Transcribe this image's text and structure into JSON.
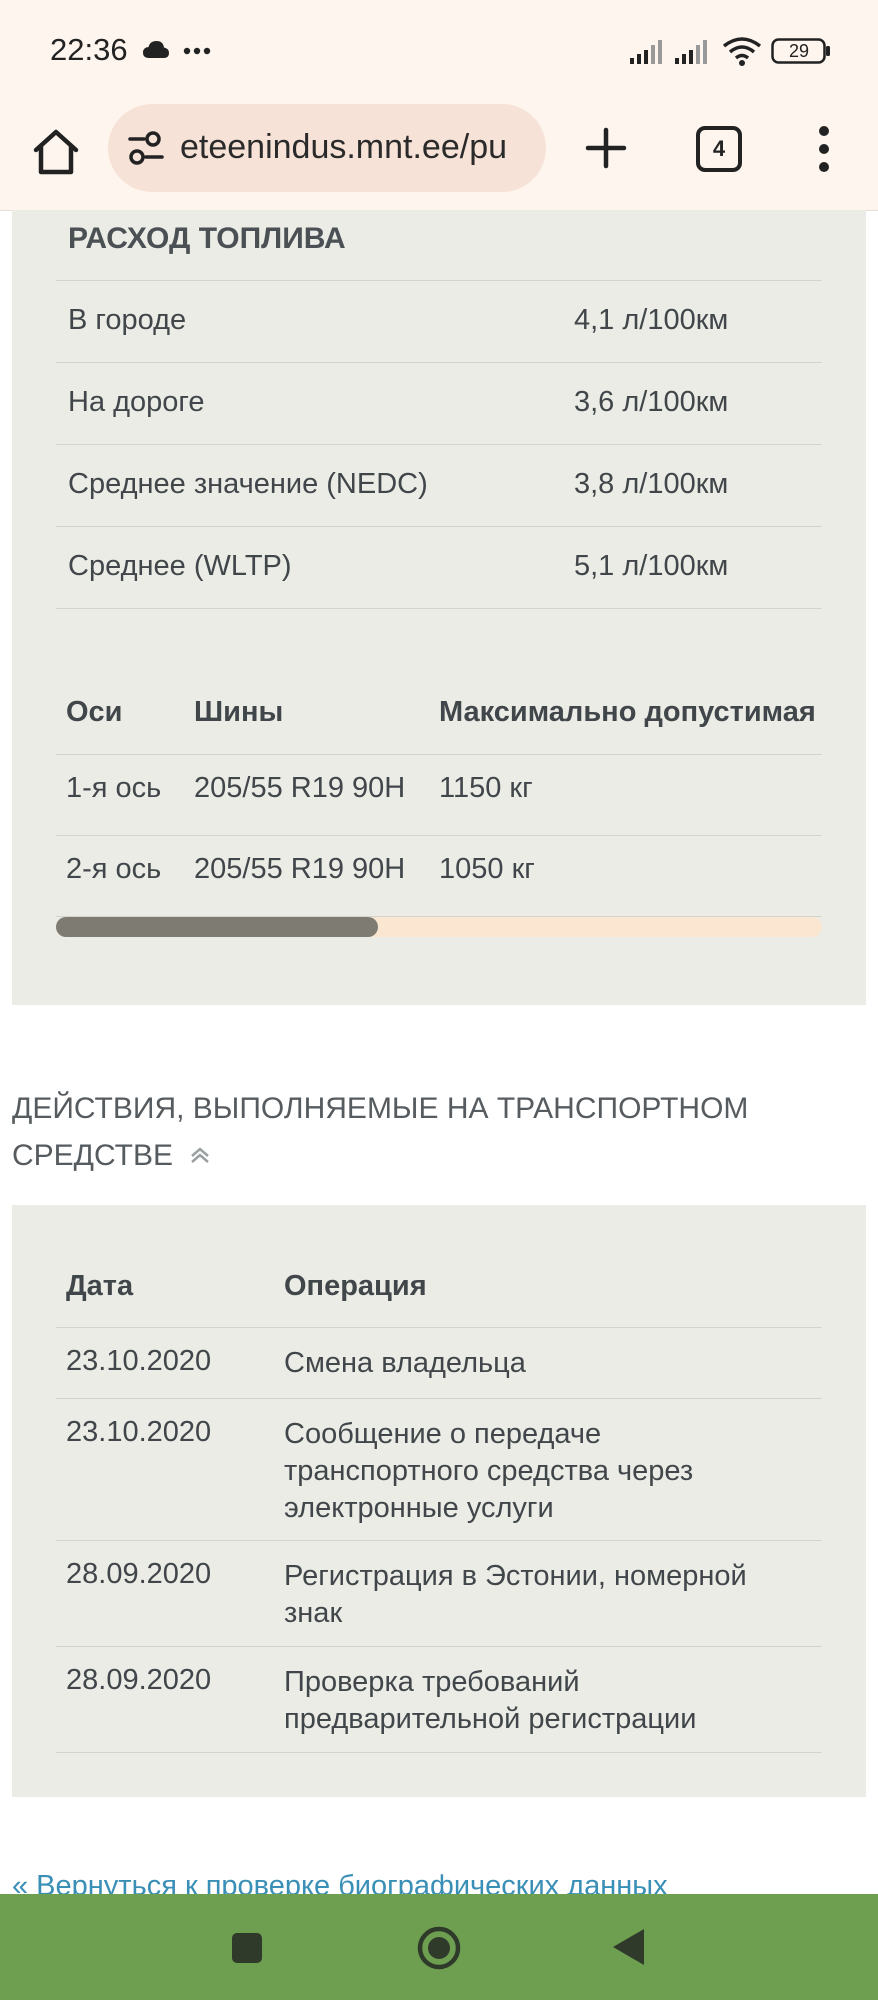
{
  "status_bar": {
    "time": "22:36",
    "battery": "29",
    "icons": [
      "cloud-icon",
      "more-dots-icon",
      "signal-icon",
      "signal-icon",
      "wifi-icon",
      "battery-icon"
    ]
  },
  "browser": {
    "url": "eteenindus.mnt.ee/pu",
    "tab_count": "4"
  },
  "fuel": {
    "title": "РАСХОД ТОПЛИВА",
    "rows": [
      {
        "label": "В городе",
        "value": "4,1 л/100км"
      },
      {
        "label": "На дороге",
        "value": "3,6 л/100км"
      },
      {
        "label": "Среднее значение (NEDC)",
        "value": "3,8 л/100км"
      },
      {
        "label": "Среднее (WLTP)",
        "value": "5,1 л/100км"
      }
    ]
  },
  "axles": {
    "headers": [
      "Оси",
      "Шины",
      "Максимально допустимая"
    ],
    "rows": [
      [
        "1-я ось",
        "205/55 R19 90H",
        "1150 кг"
      ],
      [
        "2-я ось",
        "205/55 R19 90H",
        "1050 кг"
      ]
    ],
    "scroll_fraction": 0.42
  },
  "actions": {
    "title_line1": "ДЕЙСТВИЯ, ВЫПОЛНЯЕМЫЕ НА ТРАНСПОРТНОМ",
    "title_line2": "СРЕДСТВЕ",
    "headers": [
      "Дата",
      "Операция"
    ],
    "rows": [
      {
        "date": "23.10.2020",
        "op": [
          "Смена владельца"
        ]
      },
      {
        "date": "23.10.2020",
        "op": [
          "Сообщение о передаче",
          "транспортного средства через",
          "электронные услуги"
        ]
      },
      {
        "date": "28.09.2020",
        "op": [
          "Регистрация в Эстонии, номерной",
          "знак"
        ]
      },
      {
        "date": "28.09.2020",
        "op": [
          "Проверка требований",
          "предварительной регистрации"
        ]
      }
    ]
  },
  "back_link": "« Вернуться к проверке биографических данных",
  "colors": {
    "panel": "#ebece5",
    "navbar": "#6e9e50",
    "link": "#3a8fb7",
    "statusbar": "#fdf5ee"
  }
}
